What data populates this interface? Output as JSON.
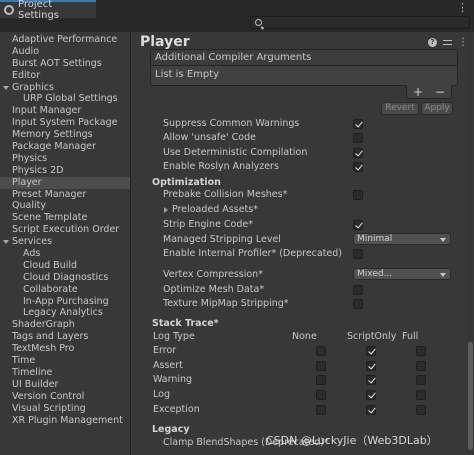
{
  "window": {
    "tab_title": "Project Settings",
    "search": {
      "value": "",
      "placeholder": ""
    }
  },
  "sidebar": {
    "items": [
      {
        "label": "Adaptive Performance",
        "indent": 0
      },
      {
        "label": "Audio",
        "indent": 0
      },
      {
        "label": "Burst AOT Settings",
        "indent": 0
      },
      {
        "label": "Editor",
        "indent": 0
      },
      {
        "label": "Graphics",
        "indent": 0,
        "expanded": true
      },
      {
        "label": "URP Global Settings",
        "indent": 2
      },
      {
        "label": "Input Manager",
        "indent": 0
      },
      {
        "label": "Input System Package",
        "indent": 0
      },
      {
        "label": "Memory Settings",
        "indent": 0
      },
      {
        "label": "Package Manager",
        "indent": 0
      },
      {
        "label": "Physics",
        "indent": 0
      },
      {
        "label": "Physics 2D",
        "indent": 0
      },
      {
        "label": "Player",
        "indent": 0,
        "selected": true
      },
      {
        "label": "Preset Manager",
        "indent": 0
      },
      {
        "label": "Quality",
        "indent": 0
      },
      {
        "label": "Scene Template",
        "indent": 0
      },
      {
        "label": "Script Execution Order",
        "indent": 0
      },
      {
        "label": "Services",
        "indent": 0,
        "expanded": true
      },
      {
        "label": "Ads",
        "indent": 2
      },
      {
        "label": "Cloud Build",
        "indent": 2
      },
      {
        "label": "Cloud Diagnostics",
        "indent": 2
      },
      {
        "label": "Collaborate",
        "indent": 2
      },
      {
        "label": "In-App Purchasing",
        "indent": 2
      },
      {
        "label": "Legacy Analytics",
        "indent": 2
      },
      {
        "label": "ShaderGraph",
        "indent": 0
      },
      {
        "label": "Tags and Layers",
        "indent": 0
      },
      {
        "label": "TextMesh Pro",
        "indent": 0
      },
      {
        "label": "Time",
        "indent": 0
      },
      {
        "label": "Timeline",
        "indent": 0
      },
      {
        "label": "UI Builder",
        "indent": 0
      },
      {
        "label": "Version Control",
        "indent": 0
      },
      {
        "label": "Visual Scripting",
        "indent": 0
      },
      {
        "label": "XR Plugin Management",
        "indent": 0
      }
    ]
  },
  "main": {
    "title": "Player",
    "compiler_args": {
      "header": "Additional Compiler Arguments",
      "empty_text": "List is Empty",
      "add": "+",
      "remove": "−"
    },
    "revert_label": "Revert",
    "apply_label": "Apply",
    "script_options": [
      {
        "label": "Suppress Common Warnings",
        "checked": true
      },
      {
        "label": "Allow 'unsafe' Code",
        "checked": false
      },
      {
        "label": "Use Deterministic Compilation",
        "checked": true
      },
      {
        "label": "Enable Roslyn Analyzers",
        "checked": true
      }
    ],
    "optimization": {
      "title": "Optimization",
      "prebake": {
        "label": "Prebake Collision Meshes*",
        "checked": false
      },
      "preloaded": {
        "label": "Preloaded Assets*"
      },
      "strip_engine": {
        "label": "Strip Engine Code*",
        "checked": true
      },
      "managed_stripping": {
        "label": "Managed Stripping Level",
        "value": "Minimal"
      },
      "internal_profiler": {
        "label": "Enable Internal Profiler* (Deprecated)",
        "checked": false
      },
      "vertex_compression": {
        "label": "Vertex Compression*",
        "value": "Mixed..."
      },
      "optimize_mesh": {
        "label": "Optimize Mesh Data*",
        "checked": false
      },
      "texture_mipmap": {
        "label": "Texture MipMap Stripping*",
        "checked": false
      }
    },
    "stack_trace": {
      "title": "Stack Trace*",
      "headers": [
        "Log Type",
        "None",
        "ScriptOnly",
        "Full"
      ],
      "rows": [
        {
          "label": "Error",
          "value": "ScriptOnly"
        },
        {
          "label": "Assert",
          "value": "ScriptOnly"
        },
        {
          "label": "Warning",
          "value": "ScriptOnly"
        },
        {
          "label": "Log",
          "value": "ScriptOnly"
        },
        {
          "label": "Exception",
          "value": "ScriptOnly"
        }
      ]
    },
    "legacy": {
      "title": "Legacy",
      "clamp_label": "Clamp BlendShapes (Deprecated)*"
    }
  },
  "watermark": "CSDN @LuckyJie（Web3DLab）"
}
